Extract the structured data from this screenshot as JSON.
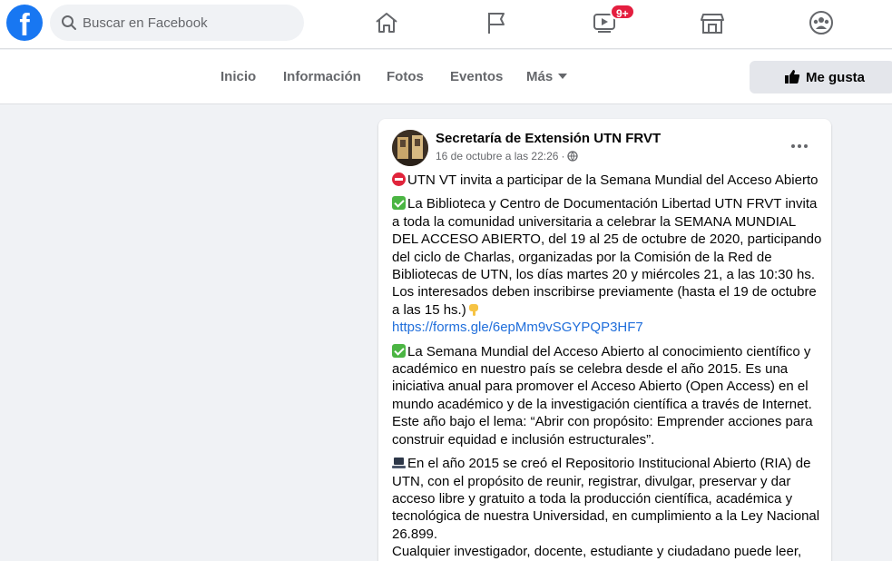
{
  "colors": {
    "brand": "#1877f2",
    "badge": "#e41e3f",
    "link": "#216fdb",
    "muted": "#65676b"
  },
  "topbar": {
    "logo_letter": "f",
    "search_placeholder": "Buscar en Facebook",
    "nav_icons": [
      "home-icon",
      "flag-icon",
      "watch-icon",
      "marketplace-icon",
      "groups-icon"
    ],
    "watch_badge": "9+"
  },
  "subnav": {
    "tabs": [
      "Inicio",
      "Información",
      "Fotos",
      "Eventos",
      "Más"
    ],
    "like_button": "Me gusta"
  },
  "post": {
    "author": "Secretaría de Extensión UTN FRVT",
    "date": "16 de octubre a las 22:26",
    "dot": "·",
    "visibility_icon": "globe-icon",
    "p1": "UTN VT invita a participar de la Semana Mundial del Acceso Abierto",
    "p2a": "La Biblioteca y Centro de Documentación Libertad UTN FRVT invita a toda la comunidad universitaria a celebrar la SEMANA MUNDIAL DEL ACCESO ABIERTO, del 19 al 25 de octubre de 2020, participando del ciclo de Charlas, organizadas por la Comisión de la Red de Bibliotecas de UTN, los días martes 20 y miércoles 21, a las 10:30 hs.",
    "p2b": "Los interesados deben inscribirse previamente (hasta el 19 de octubre a las 15 hs.)",
    "link": "https://forms.gle/6epMm9vSGYPQP3HF7",
    "p3": "La Semana Mundial del Acceso Abierto al conocimiento científico y académico en nuestro país se celebra desde el año 2015. Es una iniciativa anual para promover el Acceso Abierto (Open Access) en el mundo académico y de la investigación científica a través de Internet. Este año bajo el lema: “Abrir con propósito: Emprender acciones para construir equidad e inclusión estructurales”.",
    "p4a": "En el año 2015 se creó el Repositorio Institucional Abierto (RIA) de UTN, con el propósito de reunir, registrar, divulgar, preservar y dar acceso libre y gratuito a toda la producción científica, académica y tecnológica de nuestra Universidad, en cumplimiento a la Ley Nacional 26.899.",
    "p4b": "Cualquier investigador, docente, estudiante y ciudadano puede leer,"
  }
}
